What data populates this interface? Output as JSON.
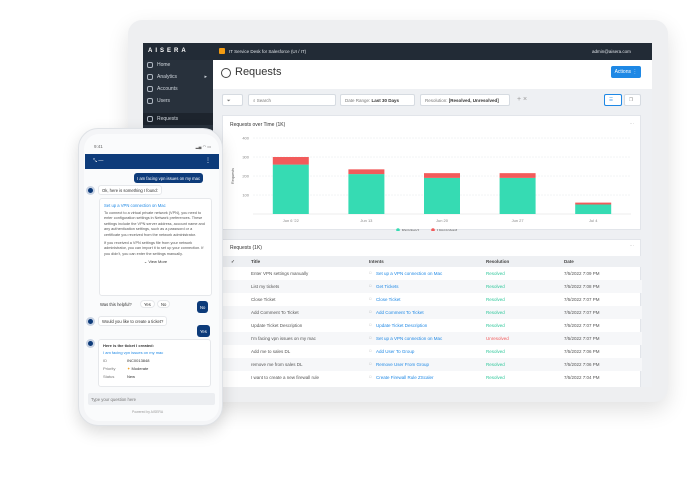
{
  "app": {
    "logo": "AISERA",
    "workspace": "IT Service Desk  for Salesforce (UI / IT)",
    "user": "admin@aisera.com"
  },
  "sidebar": {
    "items": [
      {
        "label": "Home"
      },
      {
        "label": "Analytics"
      },
      {
        "label": "Accounts"
      },
      {
        "label": "Users"
      },
      {
        "label": "Requests"
      }
    ]
  },
  "page": {
    "title": "Requests",
    "actions_label": "Actions"
  },
  "toolbar": {
    "search_placeholder": "Search",
    "date_range_label": "Date Range:",
    "date_range_value": "Last 30 Days",
    "resolution_label": "Resolution:",
    "resolution_value": "[Resolved, Unresolved]"
  },
  "chart_data": {
    "type": "bar",
    "stacked": true,
    "title": "Requests over Time (1K)",
    "ylabel": "Requests",
    "ylim": [
      0,
      400
    ],
    "yticks": [
      "100",
      "200",
      "300",
      "400"
    ],
    "categories": [
      "Jun 6 '22",
      "Jun 13",
      "Jun 20",
      "Jun 27",
      "Jul 4"
    ],
    "series": [
      {
        "name": "Resolved",
        "color": "#36dbb3",
        "values": [
          260,
          210,
          190,
          190,
          50
        ]
      },
      {
        "name": "Unresolved",
        "color": "#f25b5b",
        "values": [
          40,
          25,
          25,
          25,
          10
        ]
      }
    ],
    "grid": true,
    "legend": "bottom"
  },
  "table": {
    "title": "Requests (1K)",
    "columns": [
      "Title",
      "Intents",
      "Resolution",
      "Date"
    ],
    "rows": [
      [
        "Enter VPN settings manually",
        "Set up a VPN connection on Mac",
        "Resolved",
        "7/5/2022 7:09 PM"
      ],
      [
        "List my tickets",
        "Get Tickets",
        "Resolved",
        "7/5/2022 7:08 PM"
      ],
      [
        "Close Ticket",
        "Close Ticket",
        "Resolved",
        "7/5/2022 7:07 PM"
      ],
      [
        "Add Comment To Ticket",
        "Add Comment To Ticket",
        "Resolved",
        "7/5/2022 7:07 PM"
      ],
      [
        "Update Ticket Description",
        "Update Ticket Description",
        "Resolved",
        "7/5/2022 7:07 PM"
      ],
      [
        "I'm facing vpn issues on my mac",
        "Set up a VPN connection on Mac",
        "Unresolved",
        "7/5/2022 7:07 PM"
      ],
      [
        "Add me to sales DL",
        "Add User To Group",
        "Resolved",
        "7/5/2022 7:06 PM"
      ],
      [
        "remove me from sales DL",
        "Remove User From Group",
        "Resolved",
        "7/5/2022 7:06 PM"
      ],
      [
        "I want to create a new firewall rule",
        "Create Firewall Rule ZScaler",
        "Resolved",
        "7/5/2022 7:04 PM"
      ]
    ]
  },
  "colors": {
    "resolved": "#2ec79a",
    "unresolved": "#f25b5b",
    "accent": "#1e88e5",
    "phone_brand": "#0d3b7a"
  },
  "phone": {
    "time": "9:41",
    "user_msg": "I am facing vpn issues on my mac",
    "bot_found": "Ok, here is something I found:",
    "article_title": "Set up a VPN connection on Mac",
    "article_p1": "To connect to a virtual private network (VPN), you need to enter configuration settings in Network preferences. These settings include the VPN server address, account name and any authentication settings, such as a password or a certificate you received from the network administrator.",
    "article_p2": "If you received a VPN settings file from your network administrator, you can import it to set up your connection. If you didn't, you can enter the settings manually.",
    "view_more": "View More",
    "helpful_q": "Was this helpful?",
    "yes": "Yes",
    "no": "No",
    "user_no": "No",
    "bot_ticket_q": "Would you like to create a ticket?",
    "user_yes": "Yes",
    "ticket_intro": "Here is the ticket I created:",
    "ticket_link": "I am facing vpn issues on my mac",
    "ticket_fields": [
      {
        "label": "ID",
        "value": "INC0013848"
      },
      {
        "label": "Priority",
        "value": "Moderate"
      },
      {
        "label": "Status",
        "value": "New"
      }
    ],
    "input_placeholder": "Type your question here",
    "powered_by": "Powered by AISERA"
  }
}
